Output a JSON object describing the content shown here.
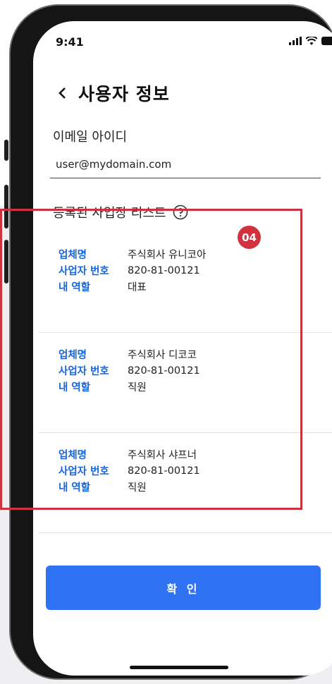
{
  "status_bar": {
    "time": "9:41"
  },
  "header": {
    "title": "사용자 정보"
  },
  "email_field": {
    "label": "이메일 아이디",
    "value": "user@mydomain.com"
  },
  "business_list": {
    "title": "등록된 사업장 리스트",
    "field_labels": {
      "company": "업체명",
      "business_number": "사업자 번호",
      "role": "내 역할"
    },
    "items": [
      {
        "company": "주식회사 유니코아",
        "business_number": "820-81-00121",
        "role": "대표"
      },
      {
        "company": "주식회사 디코코",
        "business_number": "820-81-00121",
        "role": "직원"
      },
      {
        "company": "주식회사 샤프너",
        "business_number": "820-81-00121",
        "role": "직원"
      }
    ]
  },
  "callout": {
    "badge": "04",
    "color": "#d23240"
  },
  "confirm_button": {
    "label": "확 인"
  },
  "colors": {
    "accent": "#2f72f3",
    "label_blue": "#1565e0"
  }
}
